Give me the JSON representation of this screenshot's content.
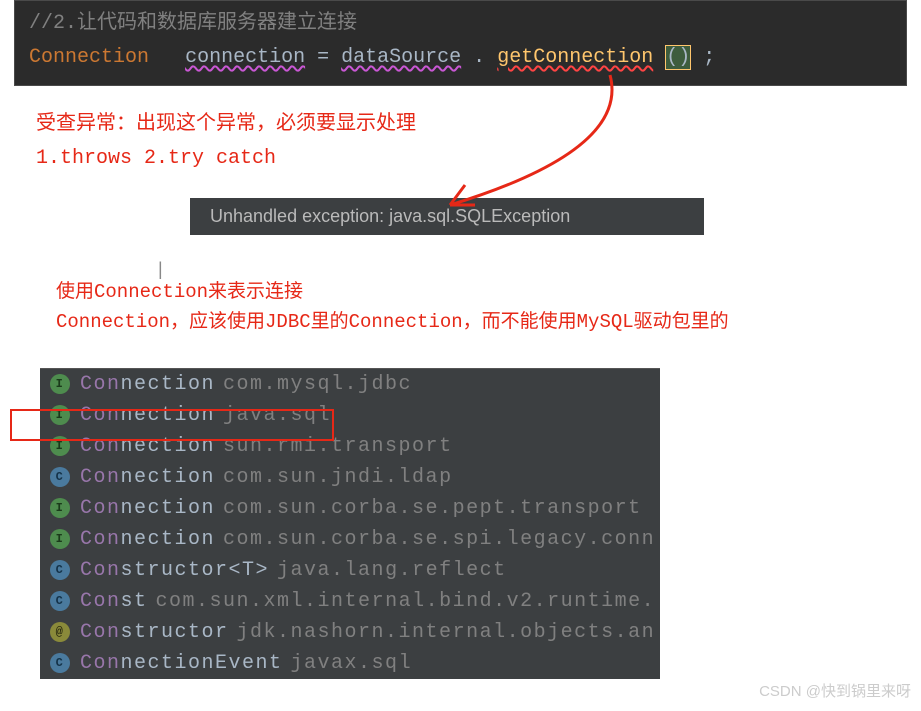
{
  "code": {
    "comment": "//2.让代码和数据库服务器建立连接",
    "type": "Connection",
    "variable": "connection",
    "equal": " = ",
    "object": "dataSource",
    "dot": ".",
    "method": "getConnection",
    "parens": "()",
    "semicolon": ";"
  },
  "annotation1": {
    "line1": "受查异常：出现这个异常，必须要显示处理",
    "line2": "1.throws   2.try catch"
  },
  "tooltip": "Unhandled exception: java.sql.SQLException",
  "annotation2": {
    "line1": "使用Connection来表示连接",
    "line2": "Connection，应该使用JDBC里的Connection，而不能使用MySQL驱动包里的"
  },
  "autocomplete": [
    {
      "icon": "I",
      "iconType": "interface",
      "match": "Con",
      "rest": "nection",
      "package": "com.mysql.jdbc"
    },
    {
      "icon": "I",
      "iconType": "interface",
      "match": "Con",
      "rest": "nection",
      "package": "java.sql"
    },
    {
      "icon": "I",
      "iconType": "interface",
      "match": "Con",
      "rest": "nection",
      "package": "sun.rmi.transport"
    },
    {
      "icon": "C",
      "iconType": "class",
      "match": "Con",
      "rest": "nection",
      "package": "com.sun.jndi.ldap"
    },
    {
      "icon": "I",
      "iconType": "interface",
      "match": "Con",
      "rest": "nection",
      "package": "com.sun.corba.se.pept.transport"
    },
    {
      "icon": "I",
      "iconType": "interface",
      "match": "Con",
      "rest": "nection",
      "package": "com.sun.corba.se.spi.legacy.conn"
    },
    {
      "icon": "C",
      "iconType": "class",
      "match": "Con",
      "rest": "structor<T>",
      "package": "java.lang.reflect"
    },
    {
      "icon": "C",
      "iconType": "class",
      "match": "Con",
      "rest": "st",
      "package": "com.sun.xml.internal.bind.v2.runtime."
    },
    {
      "icon": "@",
      "iconType": "annotation",
      "match": "Con",
      "rest": "structor",
      "package": "jdk.nashorn.internal.objects.an"
    },
    {
      "icon": "C",
      "iconType": "class",
      "match": "Con",
      "rest": "nectionEvent",
      "package": "javax.sql"
    }
  ],
  "watermark": "CSDN @快到锅里来呀"
}
